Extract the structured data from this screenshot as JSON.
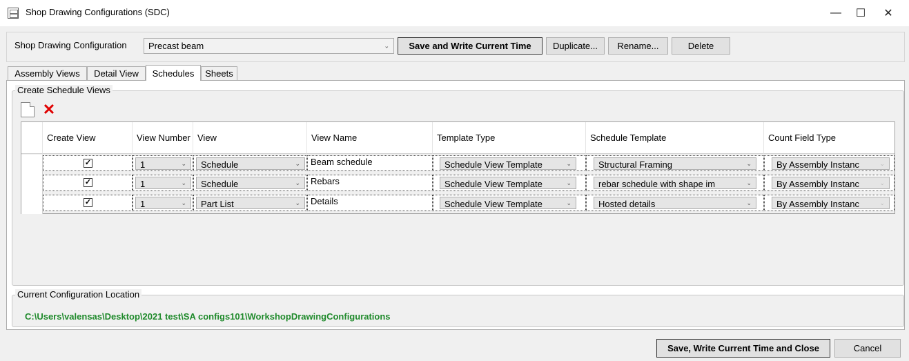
{
  "window": {
    "title": "Shop Drawing Configurations (SDC)",
    "minimize": "—",
    "maximize": "☐",
    "close": "✕"
  },
  "config": {
    "label": "Shop Drawing Configuration",
    "selected": "Precast beam",
    "save_write_label": "Save and Write Current Time",
    "duplicate_label": "Duplicate...",
    "rename_label": "Rename...",
    "delete_label": "Delete"
  },
  "tabs": [
    {
      "label": "Assembly Views",
      "active": false
    },
    {
      "label": "Detail View",
      "active": false
    },
    {
      "label": "Schedules",
      "active": true
    },
    {
      "label": "Sheets",
      "active": false
    }
  ],
  "schedule_group": {
    "title": "Create Schedule Views",
    "new_icon": "new-document-icon",
    "delete_icon": "red-x-icon"
  },
  "grid": {
    "columns": [
      "Create View",
      "View Number",
      "View",
      "View Name",
      "Template Type",
      "Schedule Template",
      "Count Field Type"
    ],
    "rows": [
      {
        "create": true,
        "number": "1",
        "view": "Schedule",
        "name": "Beam schedule",
        "template_type": "Schedule View Template",
        "schedule_template": "Structural Framing",
        "count_field": "By Assembly Instanc"
      },
      {
        "create": true,
        "number": "1",
        "view": "Schedule",
        "name": "Rebars",
        "template_type": "Schedule View Template",
        "schedule_template": "rebar schedule with shape im",
        "count_field": "By Assembly Instanc"
      },
      {
        "create": true,
        "number": "1",
        "view": "Part List",
        "name": "Details",
        "template_type": "Schedule View Template",
        "schedule_template": "Hosted details",
        "count_field": "By Assembly Instanc"
      }
    ]
  },
  "location": {
    "title": "Current Configuration Location",
    "path": "C:\\Users\\valensas\\Desktop\\2021 test\\SA configs101\\WorkshopDrawingConfigurations"
  },
  "footer": {
    "save_close_label": "Save, Write Current Time and Close",
    "cancel_label": "Cancel"
  },
  "colors": {
    "path_green": "#1f8a2b",
    "delete_red": "#e00000"
  }
}
